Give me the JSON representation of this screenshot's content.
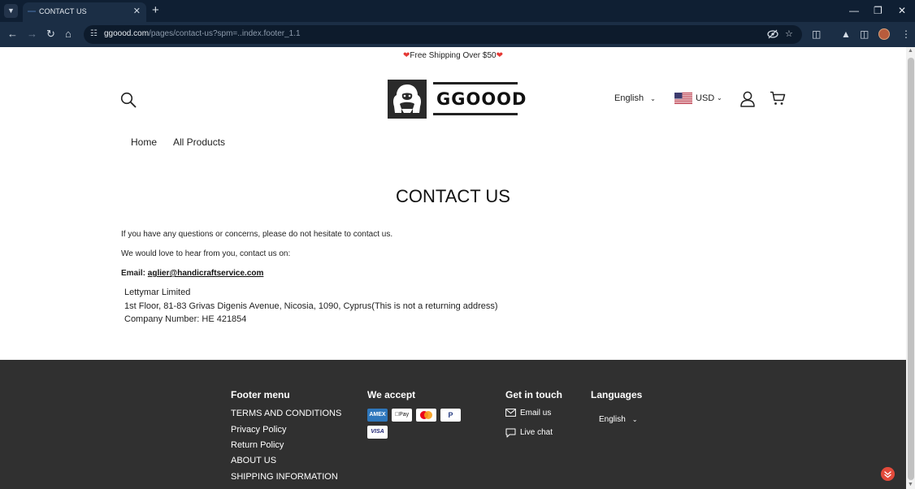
{
  "browser": {
    "tab_title": "CONTACT US",
    "url_domain": "ggoood.com",
    "url_path": "/pages/contact-us?spm=..index.footer_1.1"
  },
  "announcement": {
    "text": "Free Shipping Over $50"
  },
  "header": {
    "logo_text": "GGOOOD",
    "language": "English",
    "currency": "USD"
  },
  "nav": {
    "items": [
      "Home",
      "All Products"
    ]
  },
  "page": {
    "title": "CONTACT US",
    "intro": "If you have any questions or concerns, please do not hesitate to contact us.",
    "love": "We would love to hear from you, contact us on:",
    "email_label": "Email:",
    "email": "aglier@handicraftservice.com",
    "address_lines": [
      "Lettymar Limited",
      "1st Floor, 81-83 Grivas Digenis Avenue, Nicosia, 1090, Cyprus(This is not a returning address)",
      "Company Number:  HE 421854"
    ]
  },
  "footer": {
    "menu_title": "Footer menu",
    "menu_items": [
      "TERMS AND CONDITIONS",
      "Privacy Policy",
      "Return Policy",
      "ABOUT US",
      "SHIPPING INFORMATION"
    ],
    "accept_title": "We accept",
    "cards": [
      "AMEX",
      "Pay",
      "",
      "P",
      "VISA"
    ],
    "touch_title": "Get in touch",
    "email_us": "Email us",
    "live_chat": "Live chat",
    "languages_title": "Languages",
    "language": "English"
  },
  "colors": {
    "footer_bg": "#303030",
    "chrome_bg": "#1b2e45",
    "accent_red": "#e53935"
  }
}
